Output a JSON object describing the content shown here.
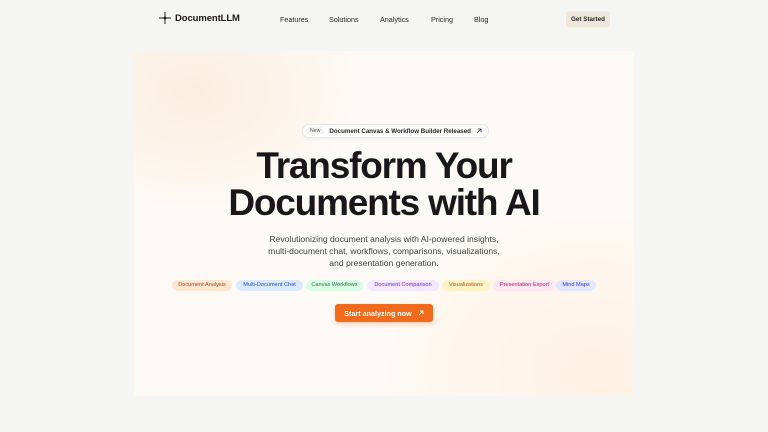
{
  "nav": {
    "brand": "DocumentLLM",
    "brand_icon": "sparkle-cross-icon",
    "links": [
      "Features",
      "Solutions",
      "Analytics",
      "Pricing",
      "Blog"
    ],
    "cta_label": "Get Started"
  },
  "hero": {
    "announcement": {
      "badge": "New",
      "text": "Document Canvas & Workflow Builder Released",
      "icon": "arrow-up-right-icon"
    },
    "headline_line1": "Transform Your",
    "headline_line2": "Documents with AI",
    "subtitle": "Revolutionizing document analysis with AI-powered insights, multi-document chat, workflows, comparisons, visualizations, and presentation generation.",
    "tags": [
      {
        "label": "Document Analysis",
        "bg": "#fde7d3",
        "color": "#c2410c"
      },
      {
        "label": "Multi-Document Chat",
        "bg": "#dbeafe",
        "color": "#1d4ed8"
      },
      {
        "label": "Canvas Workflows",
        "bg": "#dcfce7",
        "color": "#15803d"
      },
      {
        "label": "Document Comparison",
        "bg": "#f3e8ff",
        "color": "#7e22ce"
      },
      {
        "label": "Visualizations",
        "bg": "#fef3c7",
        "color": "#b45309"
      },
      {
        "label": "Presentation Export",
        "bg": "#fce7f3",
        "color": "#be185d"
      },
      {
        "label": "Mind Maps",
        "bg": "#e0e7ff",
        "color": "#4338ca"
      }
    ],
    "cta_label": "Start analyzing now",
    "cta_icon": "arrow-up-right-icon",
    "accent": "#f26b1d"
  }
}
